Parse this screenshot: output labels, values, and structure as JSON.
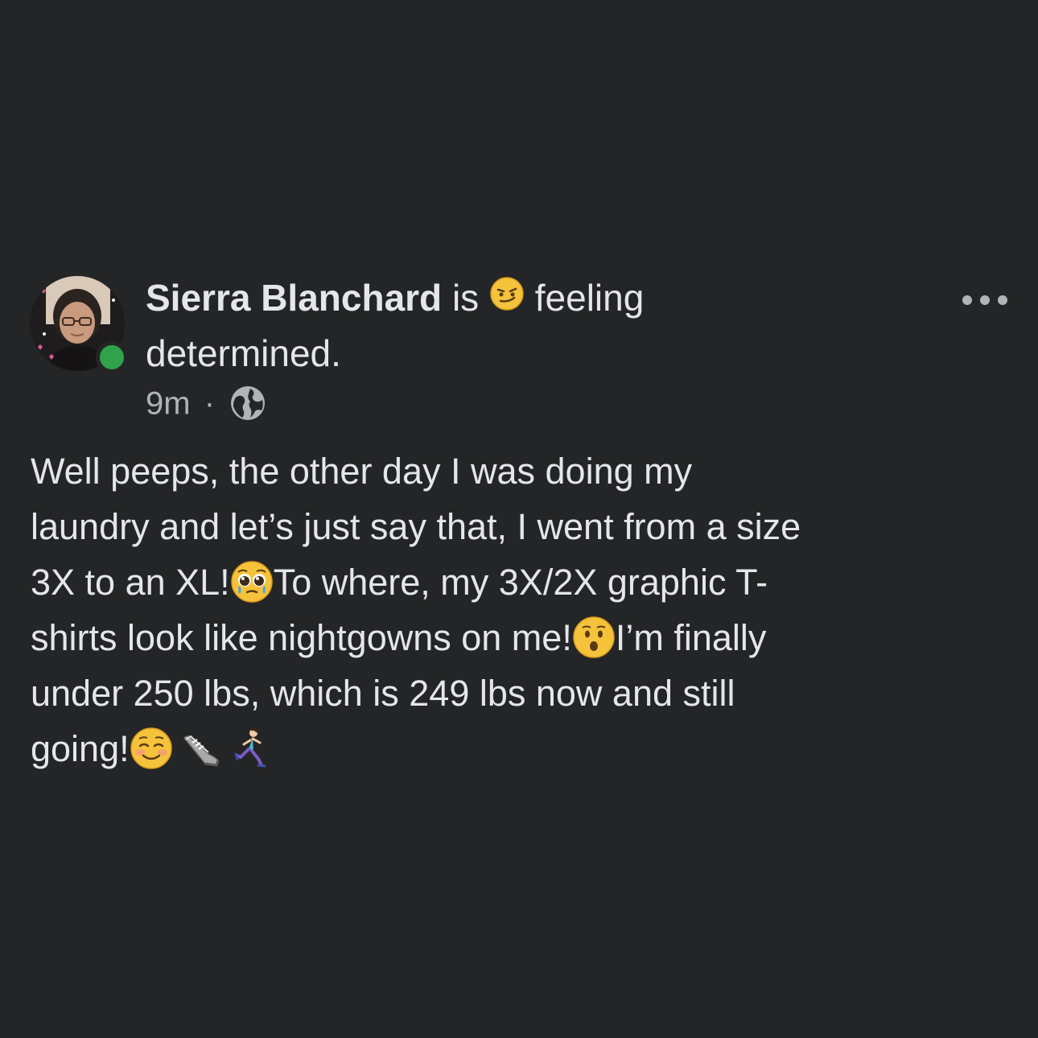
{
  "post": {
    "author": "Sierra Blanchard",
    "feeling_prefix": "is",
    "feeling_word": "feeling",
    "feeling_state": "determined.",
    "timestamp": "9m",
    "separator": "·",
    "privacy_icon": "globe-icon",
    "more_icon": "more-options-icon",
    "online_status_color": "#31a24c",
    "body_lines": [
      "Well peeps, the other day I was doing my",
      "laundry and let’s just say that, I went from a size",
      "3X to an XL!",
      "To where, my 3X/2X graphic T-",
      "shirts look like nightgowns on me!",
      "I’m finally",
      "under 250 lbs, which is 249 lbs now and still",
      "going!"
    ],
    "emojis": [
      "smirk-emoji",
      "pleading-face-emoji",
      "hushed-face-emoji",
      "smiling-face-emoji",
      "sneaker-emoji",
      "running-woman-emoji"
    ]
  },
  "colors": {
    "background": "#242526",
    "primary_text": "#e4e6eb",
    "secondary_text": "#b0b3b8"
  }
}
